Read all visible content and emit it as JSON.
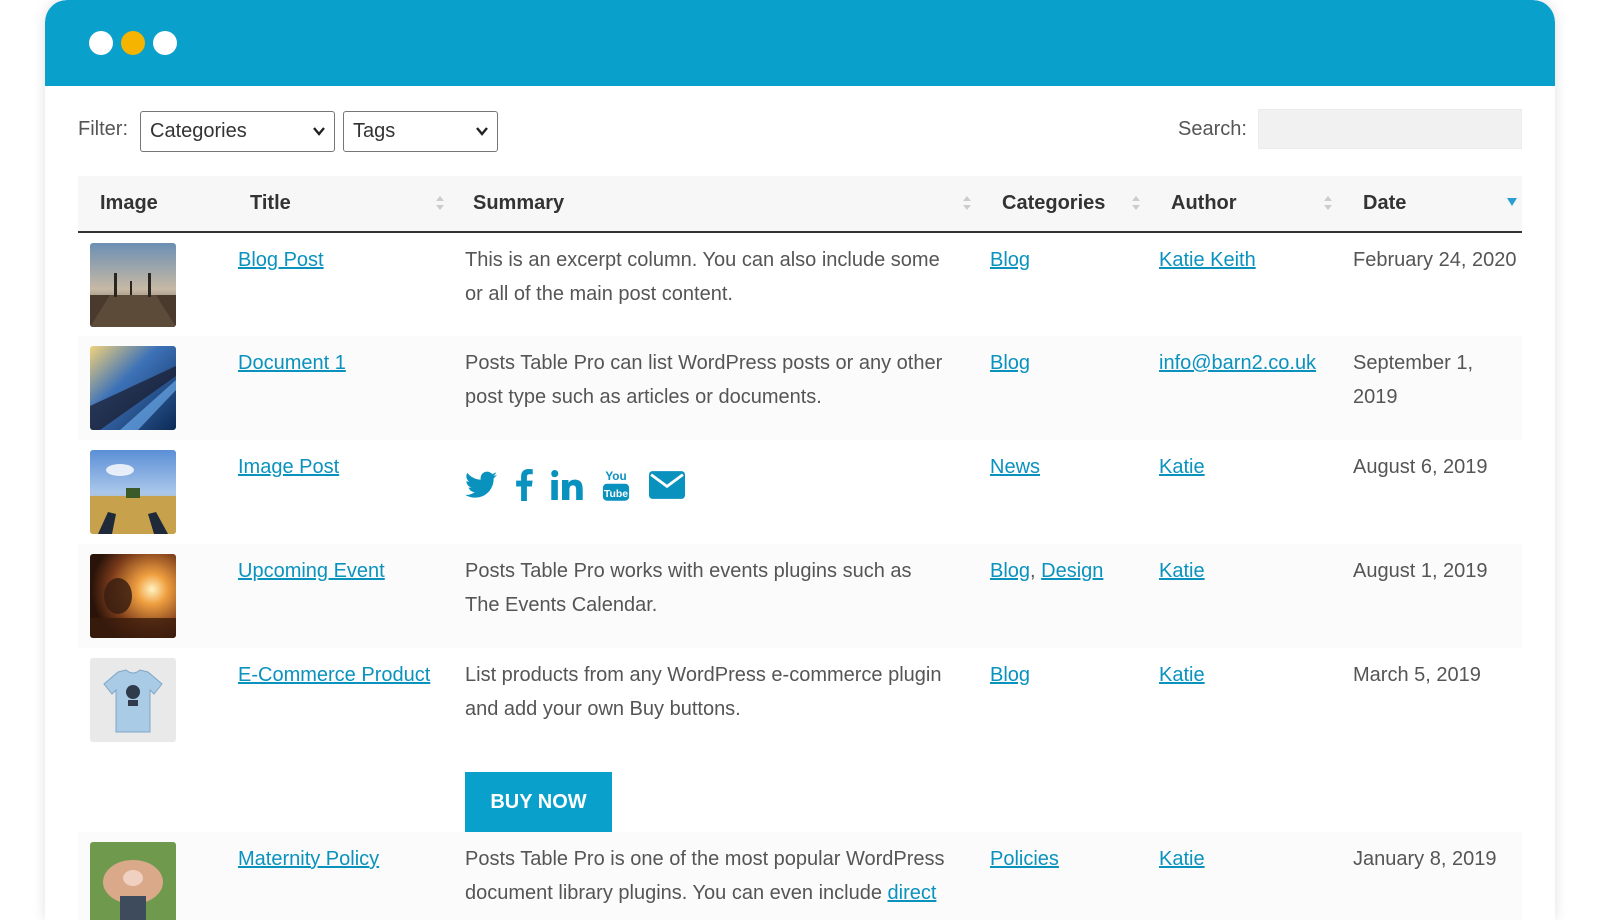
{
  "window": {
    "dots": [
      "close",
      "minimize",
      "maximize"
    ]
  },
  "toolbar": {
    "filter_label": "Filter:",
    "categories_select": "Categories",
    "tags_select": "Tags",
    "search_label": "Search:",
    "search_value": ""
  },
  "table": {
    "headers": {
      "image": "Image",
      "title": "Title",
      "summary": "Summary",
      "categories": "Categories",
      "author": "Author",
      "date": "Date"
    },
    "rows": [
      {
        "title": "Blog Post",
        "summary": "This is an excerpt column. You can also include some or all of the main post content.",
        "categories": [
          "Blog"
        ],
        "author": "Katie Keith",
        "date": "February 24, 2020"
      },
      {
        "title": "Document 1",
        "summary": "Posts Table Pro can list WordPress posts or any other post type such as articles or documents.",
        "categories": [
          "Blog"
        ],
        "author": "info@barn2.co.uk",
        "date": "September 1, 2019"
      },
      {
        "title": "Image Post",
        "summary_icons": [
          "twitter-icon",
          "facebook-icon",
          "linkedin-icon",
          "youtube-icon",
          "email-icon"
        ],
        "categories": [
          "News"
        ],
        "author": "Katie",
        "date": "August 6, 2019"
      },
      {
        "title": "Upcoming Event",
        "summary": "Posts Table Pro works with events plugins such as The Events Calendar.",
        "categories": [
          "Blog",
          "Design"
        ],
        "author": "Katie",
        "date": "August 1, 2019"
      },
      {
        "title": "E-Commerce Product",
        "summary": "List products from any WordPress e-commerce plugin and add your own Buy buttons.",
        "button": "BUY NOW",
        "categories": [
          "Blog"
        ],
        "author": "Katie",
        "date": "March 5, 2019"
      },
      {
        "title": "Maternity Policy",
        "summary": "Posts Table Pro is one of the most popular WordPress document library plugins. You can even include",
        "summary_link": "direct",
        "categories": [
          "Policies"
        ],
        "author": "Katie",
        "date": "January 8, 2019"
      }
    ]
  },
  "colors": {
    "accent": "#0aa0cc",
    "link": "#0a92bf",
    "dot_yellow": "#f4b400"
  }
}
